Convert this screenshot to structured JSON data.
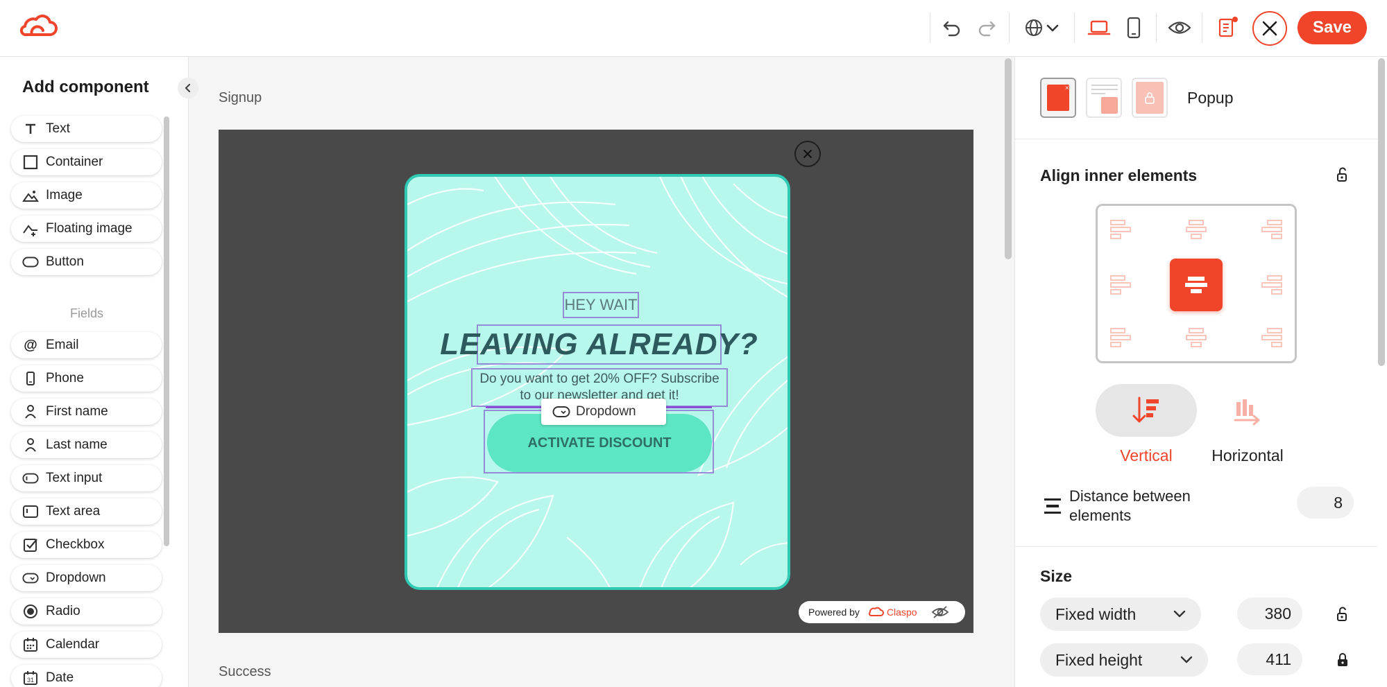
{
  "toolbar": {
    "save_label": "Save",
    "icons": [
      "logo-icon",
      "undo-icon",
      "redo-icon",
      "globe-icon",
      "chevron-down-icon",
      "laptop-icon",
      "mobile-icon",
      "eye-icon",
      "checklist-icon",
      "close-icon"
    ]
  },
  "sidebar": {
    "title": "Add component",
    "components": [
      {
        "label": "Text",
        "icon": "text-icon"
      },
      {
        "label": "Container",
        "icon": "square-icon"
      },
      {
        "label": "Image",
        "icon": "image-icon"
      },
      {
        "label": "Floating image",
        "icon": "floating-image-icon"
      },
      {
        "label": "Button",
        "icon": "button-icon"
      }
    ],
    "fields_label": "Fields",
    "fields": [
      {
        "label": "Email",
        "icon": "at-icon"
      },
      {
        "label": "Phone",
        "icon": "phone-icon"
      },
      {
        "label": "First name",
        "icon": "person-icon"
      },
      {
        "label": "Last name",
        "icon": "person-icon"
      },
      {
        "label": "Text input",
        "icon": "text-input-icon"
      },
      {
        "label": "Text area",
        "icon": "text-area-icon"
      },
      {
        "label": "Checkbox",
        "icon": "checkbox-icon"
      },
      {
        "label": "Dropdown",
        "icon": "dropdown-icon"
      },
      {
        "label": "Radio",
        "icon": "radio-icon"
      },
      {
        "label": "Calendar",
        "icon": "calendar-icon"
      },
      {
        "label": "Date",
        "icon": "date-icon"
      }
    ]
  },
  "canvas": {
    "signup_label": "Signup",
    "success_label": "Success",
    "popup": {
      "kicker": "HEY WAIT",
      "headline": "LEAVING ALREADY?",
      "description": "Do you want to get 20% OFF? Subscribe to our newsletter and get it!",
      "button_label": "ACTIVATE DISCOUNT",
      "drag_tag_label": "Dropdown",
      "background_color": "#b8f7ec",
      "border_color": "#2fc9b4",
      "button_color": "#5de6c4"
    },
    "powered_by": "Powered by",
    "brand_name": "Claspo"
  },
  "right_panel": {
    "popup_type_label": "Popup",
    "align_title": "Align inner elements",
    "direction": {
      "vertical_label": "Vertical",
      "horizontal_label": "Horizontal",
      "selected": "Vertical"
    },
    "distance_label": "Distance between elements",
    "distance_value": "8",
    "size_title": "Size",
    "width_mode": "Fixed width",
    "width_value": "380",
    "height_mode": "Fixed height",
    "height_value": "411"
  },
  "colors": {
    "accent": "#f0452a",
    "stage": "#494949",
    "panel_border": "#e6e6e6"
  }
}
